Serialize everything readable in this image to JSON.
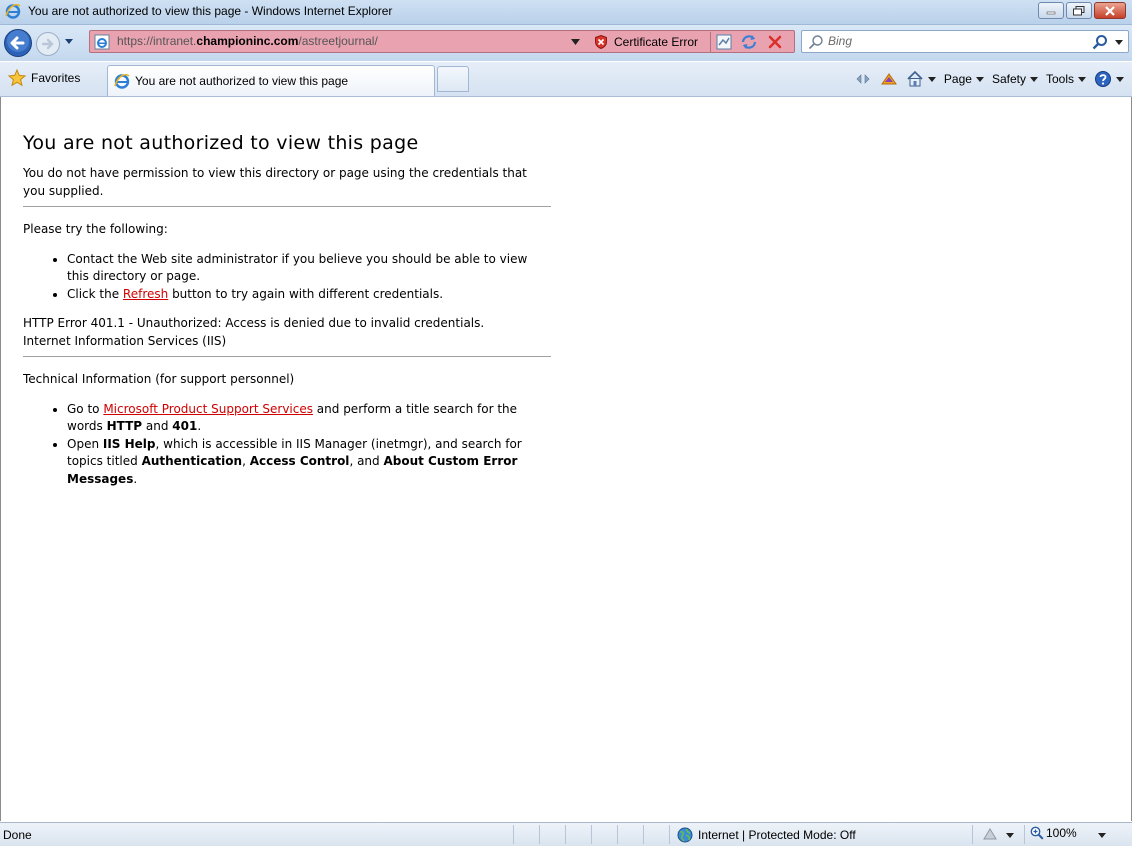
{
  "window": {
    "title": "You are not authorized to view this page - Windows Internet Explorer"
  },
  "address": {
    "url_prefix": "https://intranet.",
    "url_domain": "championinc.com",
    "url_path": "/astreetjournal/",
    "certificate_label": "Certificate Error"
  },
  "search": {
    "placeholder": "Bing"
  },
  "commandbar": {
    "favorites_label": "Favorites",
    "tab_label": "You are not authorized to view this page",
    "page_label": "Page",
    "safety_label": "Safety",
    "tools_label": "Tools"
  },
  "page": {
    "heading": "You are not authorized to view this page",
    "intro": "You do not have permission to view this directory or page using the credentials that you supplied.",
    "try_heading": "Please try the following:",
    "try_items": {
      "contact": "Contact the Web site administrator if you believe you should be able to view this directory or page.",
      "click_pre": "Click the ",
      "refresh_link": "Refresh",
      "click_post": " button to try again with different credentials."
    },
    "error_line": "HTTP Error 401.1 - Unauthorized: Access is denied due to invalid credentials.",
    "server_line": "Internet Information Services (IIS)",
    "tech_heading": "Technical Information (for support personnel)",
    "tech_items": {
      "goto_pre": "Go to ",
      "support_link": "Microsoft Product Support Services",
      "goto_mid": " and perform a title search for the words ",
      "word_http": "HTTP",
      "goto_and": " and ",
      "word_401": "401",
      "goto_end": ".",
      "open_pre": "Open ",
      "iis_help": "IIS Help",
      "open_mid": ", which is accessible in IIS Manager (inetmgr), and search for topics titled ",
      "topic_auth": "Authentication",
      "sep1": ", ",
      "topic_access": "Access Control",
      "sep2": ", and ",
      "topic_custom": "About Custom Error Messages",
      "open_end": "."
    }
  },
  "status": {
    "text": "Done",
    "zone": "Internet | Protected Mode: Off",
    "zoom": "100%"
  },
  "colors": {
    "address_error_bg": "#e9a3b0",
    "link": "#d00000",
    "titlebar": "#c4d8ee"
  },
  "icons": {
    "browser": "ie-logo-icon",
    "back": "back-arrow-icon",
    "forward": "forward-arrow-icon",
    "certificate": "shield-error-icon",
    "refresh": "refresh-icon",
    "stop": "stop-icon",
    "search": "magnifier-icon",
    "favorites": "star-icon",
    "home": "home-icon",
    "help": "help-icon",
    "globe": "globe-icon",
    "zoom": "magnifier-icon"
  }
}
